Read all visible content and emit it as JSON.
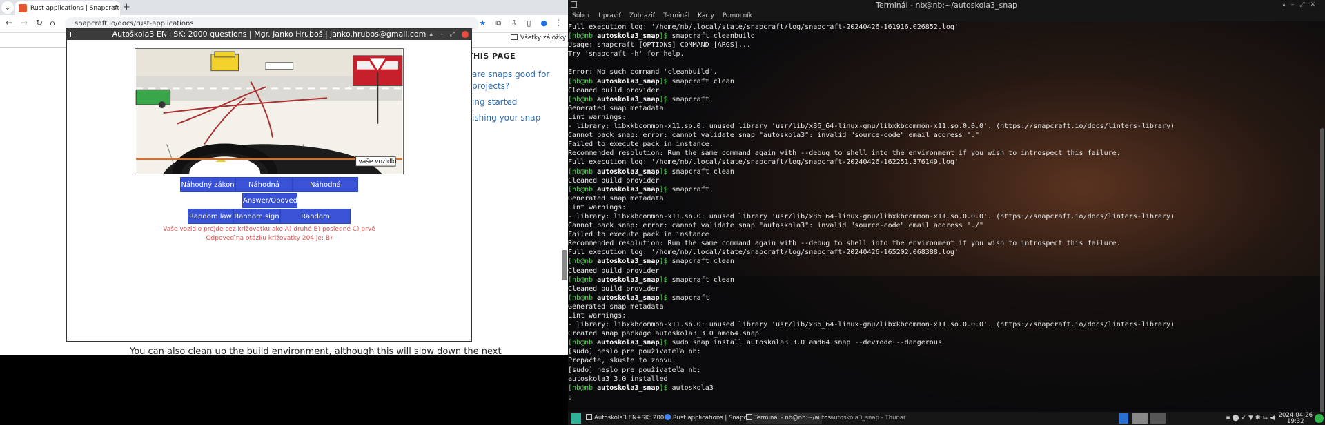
{
  "browser": {
    "tab_title": "Rust applications | Snapcraft",
    "tab_close": "✕",
    "new_tab": "+",
    "url": "snapcraft.io/docs/rust-applications",
    "bookmarks_label": "Všetky záložky",
    "toc_title": "THIS PAGE",
    "toc_links": [
      "are snaps good for",
      "projects?",
      "ing started",
      "ishing your snap"
    ],
    "page_text": "You can also clean up the build environment, although this will slow down the next"
  },
  "app": {
    "title": "Autoškola3 EN+SK: 2000 questions | Mgr. Janko Hruboš | janko.hrubos@gmail.com",
    "image_label": "vaše vozidlo",
    "buttons": {
      "random_law_sk": "Náhodný zákon",
      "random_sign_sk": "Náhodná značka",
      "random_intersection_sk": "Náhodná križovatka",
      "answer": "Answer/Opoveď",
      "random_law": "Random law",
      "random_sign": "Random sign",
      "random_intersection": "Random intersection"
    },
    "question": "Vaše vozidlo prejde cez križovatku ako A) druhé B) posledné C) prvé",
    "answer_text": "Odpoveď na otázku križovatky 204 je: B)"
  },
  "terminal": {
    "title": "Terminál - nb@nb:~/autoskola3_snap",
    "menu": [
      "Súbor",
      "Upraviť",
      "Zobraziť",
      "Terminál",
      "Karty",
      "Pomocník"
    ],
    "lines": [
      {
        "t": "o",
        "text": "Full execution log: '/home/nb/.local/state/snapcraft/log/snapcraft-20240426-161916.026852.log'"
      },
      {
        "t": "p",
        "cmd": "snapcraft cleanbuild"
      },
      {
        "t": "o",
        "text": "Usage: snapcraft [OPTIONS] COMMAND [ARGS]..."
      },
      {
        "t": "o",
        "text": "Try 'snapcraft -h' for help."
      },
      {
        "t": "o",
        "text": ""
      },
      {
        "t": "o",
        "text": "Error: No such command 'cleanbuild'."
      },
      {
        "t": "p",
        "cmd": "snapcraft clean"
      },
      {
        "t": "o",
        "text": "Cleaned build provider"
      },
      {
        "t": "p",
        "cmd": "snapcraft"
      },
      {
        "t": "o",
        "text": "Generated snap metadata"
      },
      {
        "t": "o",
        "text": "Lint warnings:"
      },
      {
        "t": "o",
        "text": "- library: libxkbcommon-x11.so.0: unused library 'usr/lib/x86_64-linux-gnu/libxkbcommon-x11.so.0.0.0'. (https://snapcraft.io/docs/linters-library)"
      },
      {
        "t": "o",
        "text": "Cannot pack snap: error: cannot validate snap \"autoskola3\": invalid \"source-code\" email address \".\""
      },
      {
        "t": "o",
        "text": "Failed to execute pack in instance."
      },
      {
        "t": "o",
        "text": "Recommended resolution: Run the same command again with --debug to shell into the environment if you wish to introspect this failure."
      },
      {
        "t": "o",
        "text": "Full execution log: '/home/nb/.local/state/snapcraft/log/snapcraft-20240426-162251.376149.log'"
      },
      {
        "t": "p",
        "cmd": "snapcraft clean"
      },
      {
        "t": "o",
        "text": "Cleaned build provider"
      },
      {
        "t": "p",
        "cmd": "snapcraft"
      },
      {
        "t": "o",
        "text": "Generated snap metadata"
      },
      {
        "t": "o",
        "text": "Lint warnings:"
      },
      {
        "t": "o",
        "text": "- library: libxkbcommon-x11.so.0: unused library 'usr/lib/x86_64-linux-gnu/libxkbcommon-x11.so.0.0.0'. (https://snapcraft.io/docs/linters-library)"
      },
      {
        "t": "o",
        "text": "Cannot pack snap: error: cannot validate snap \"autoskola3\": invalid \"source-code\" email address \"./\""
      },
      {
        "t": "o",
        "text": "Failed to execute pack in instance."
      },
      {
        "t": "o",
        "text": "Recommended resolution: Run the same command again with --debug to shell into the environment if you wish to introspect this failure."
      },
      {
        "t": "o",
        "text": "Full execution log: '/home/nb/.local/state/snapcraft/log/snapcraft-20240426-165202.068388.log'"
      },
      {
        "t": "p",
        "cmd": "snapcraft clean"
      },
      {
        "t": "o",
        "text": "Cleaned build provider"
      },
      {
        "t": "p",
        "cmd": "snapcraft clean"
      },
      {
        "t": "o",
        "text": "Cleaned build provider"
      },
      {
        "t": "p",
        "cmd": "snapcraft"
      },
      {
        "t": "o",
        "text": "Generated snap metadata"
      },
      {
        "t": "o",
        "text": "Lint warnings:"
      },
      {
        "t": "o",
        "text": "- library: libxkbcommon-x11.so.0: unused library 'usr/lib/x86_64-linux-gnu/libxkbcommon-x11.so.0.0.0'. (https://snapcraft.io/docs/linters-library)"
      },
      {
        "t": "o",
        "text": "Created snap package autoskola3_3.0_amd64.snap"
      },
      {
        "t": "p",
        "cmd": "sudo snap install autoskola3_3.0_amd64.snap --devmode --dangerous"
      },
      {
        "t": "o",
        "text": "[sudo] heslo pre používateľa nb:"
      },
      {
        "t": "o",
        "text": "Prepáčte, skúste to znovu."
      },
      {
        "t": "o",
        "text": "[sudo] heslo pre používateľa nb:"
      },
      {
        "t": "o",
        "text": "autoskola3 3.0 installed"
      },
      {
        "t": "p",
        "cmd": "autoskola3"
      },
      {
        "t": "o",
        "text": "▯"
      }
    ],
    "prompt_user": "[nb@nb",
    "prompt_dir": "autoskola3_snap",
    "prompt_end": "]$"
  },
  "taskbar": {
    "items": [
      "Autoškola3 EN+SK: 2000 ...",
      "Rust applications | Snapcr...",
      "Terminál - nb@nb:~/autos...",
      "autoskola3_snap - Thunar"
    ],
    "date": "2024-04-26",
    "time": "19:32"
  },
  "colors": {
    "button_blue": "#3a53d6",
    "prompt_green": "#4fd14f",
    "error_red": "#e05050"
  }
}
